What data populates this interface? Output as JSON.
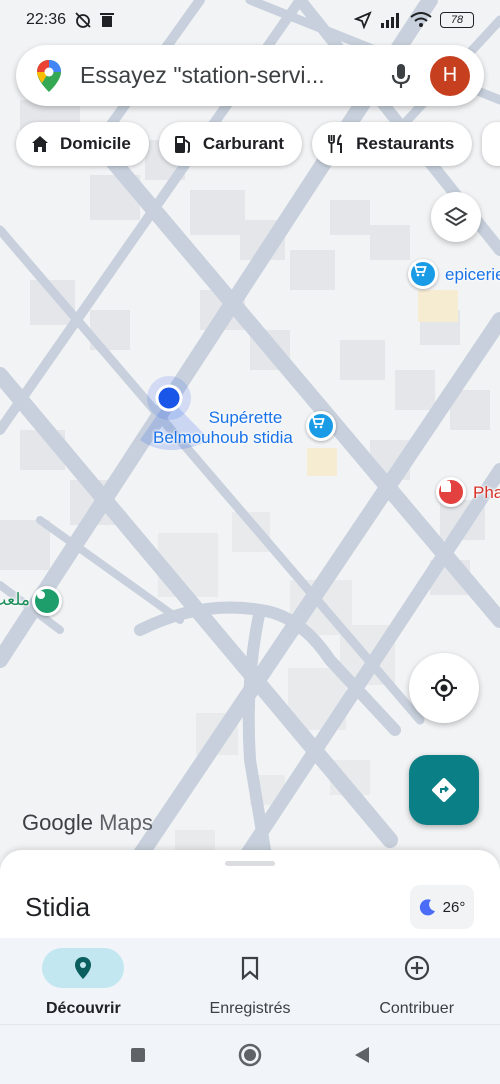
{
  "status_bar": {
    "time": "22:36",
    "battery": "78"
  },
  "search": {
    "placeholder": "Essayez \"station-servi...",
    "avatar_letter": "H"
  },
  "chips": [
    {
      "label": "Domicile",
      "icon": "home-icon"
    },
    {
      "label": "Carburant",
      "icon": "fuel-icon"
    },
    {
      "label": "Restaurants",
      "icon": "restaurant-icon"
    }
  ],
  "map": {
    "pois": {
      "epicerie": "epicerie",
      "superette_line1": "Supérette",
      "superette_line2": "Belmouhoub stidia",
      "pharmacy": "Pha",
      "left_place": "ملعب"
    },
    "logo_google": "Google",
    "logo_maps": "Maps"
  },
  "sheet": {
    "place": "Stidia",
    "temperature": "26°"
  },
  "bottom_nav": [
    {
      "label": "Découvrir",
      "icon": "explore-pin-icon",
      "active": true
    },
    {
      "label": "Enregistrés",
      "icon": "bookmark-icon",
      "active": false
    },
    {
      "label": "Contribuer",
      "icon": "add-circle-icon",
      "active": false
    }
  ],
  "colors": {
    "accent": "#0b7f86",
    "avatar": "#c6401f",
    "location_dot": "#1a56e8",
    "poi_blue": "#1a9be6",
    "poi_red": "#e2413f",
    "poi_green": "#1e9e6b"
  }
}
